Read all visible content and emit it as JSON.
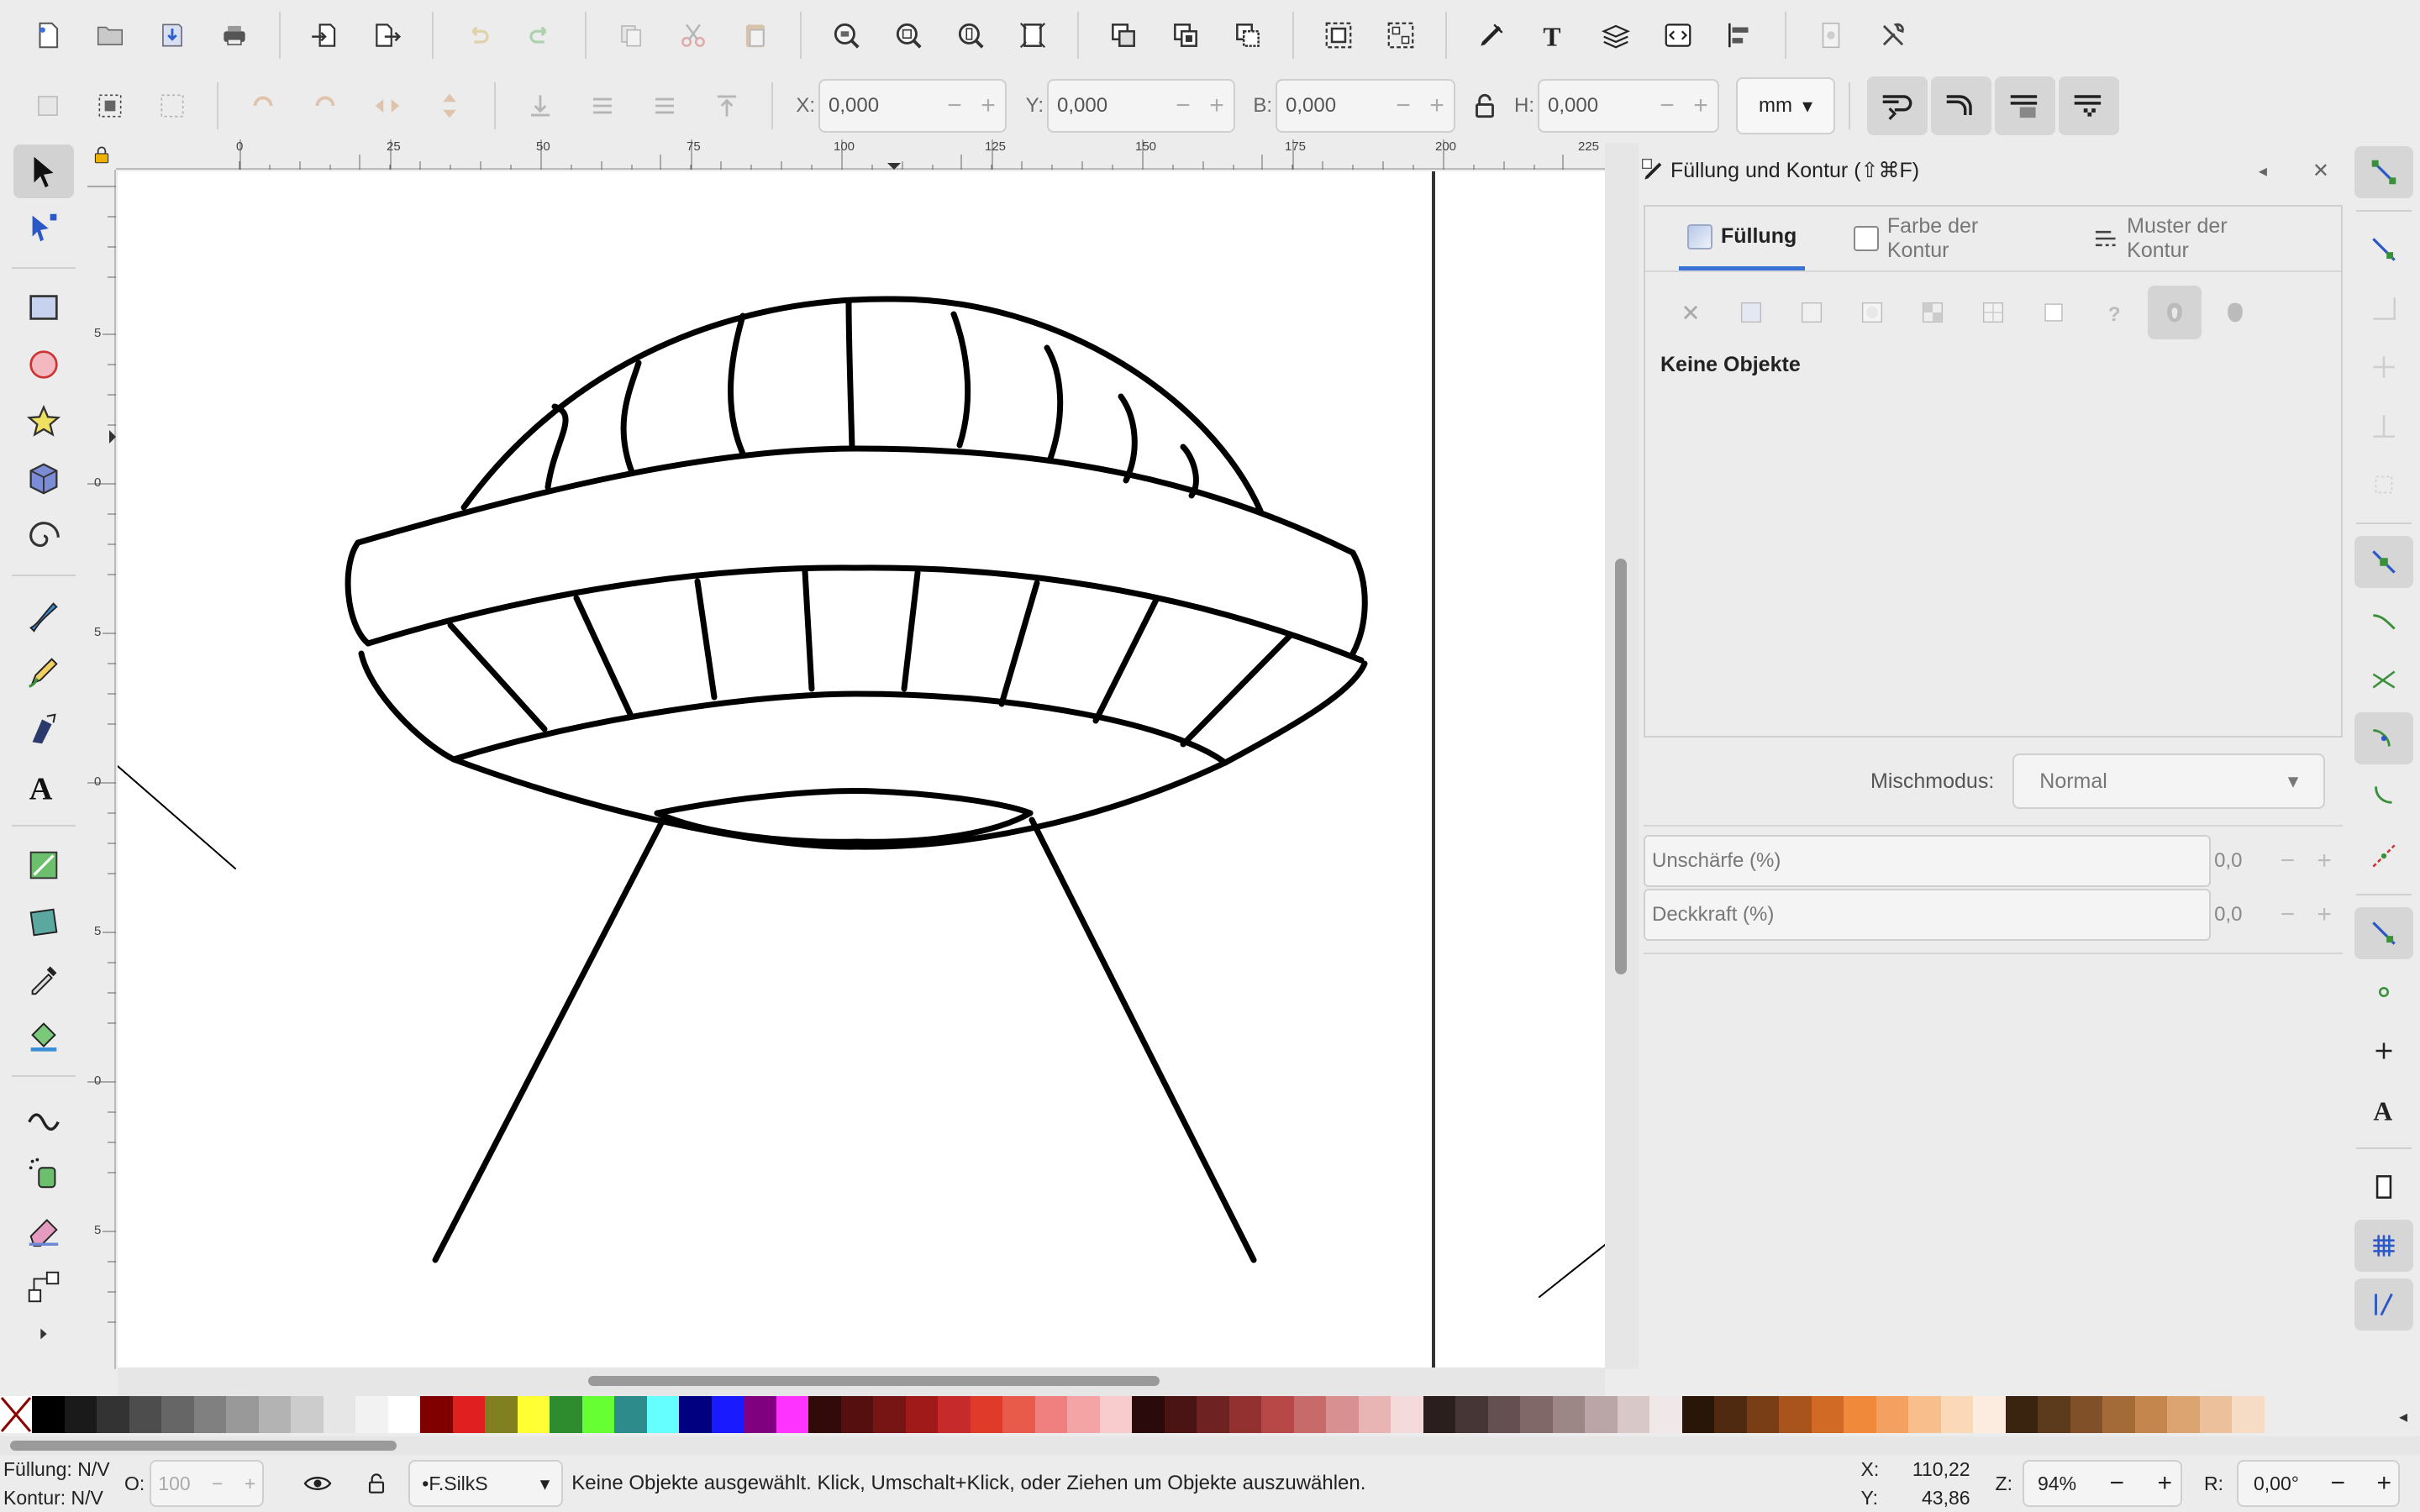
{
  "toolbar": {
    "commands": [
      "new-document",
      "open",
      "save",
      "print",
      "import",
      "export",
      "undo",
      "redo",
      "copy",
      "cut",
      "paste",
      "zoom-selection",
      "zoom-drawing",
      "zoom-page",
      "zoom-page-width",
      "duplicate",
      "clone",
      "unlink-clone",
      "group",
      "ungroup",
      "xml-editor",
      "fill-and-stroke",
      "text-and-font",
      "layers",
      "objects",
      "align-distribute",
      "preferences",
      "document-properties"
    ]
  },
  "controls": {
    "x_label": "X:",
    "x_value": "0,000",
    "y_label": "Y:",
    "y_value": "0,000",
    "w_label": "B:",
    "w_value": "0,000",
    "h_label": "H:",
    "h_value": "0,000",
    "unit": "mm"
  },
  "ruler": {
    "h_labels": [
      "0",
      "25",
      "50",
      "75",
      "100",
      "125",
      "150",
      "175",
      "200",
      "225"
    ],
    "v_labels": [
      "0",
      "5",
      "0",
      "5",
      "0",
      "5",
      "0",
      "5"
    ]
  },
  "dock": {
    "title": "Füllung und Kontur (⇧⌘F)",
    "tabs": [
      "Füllung",
      "Farbe der Kontur",
      "Muster der Kontur"
    ],
    "no_objects": "Keine Objekte",
    "blend_label": "Mischmodus:",
    "blend_value": "Normal",
    "blur_label": "Unschärfe (%)",
    "blur_value": "0,0",
    "opacity_label": "Deckkraft (%)",
    "opacity_value": "0,0"
  },
  "palette": {
    "colors": [
      "#000000",
      "#1a1a1a",
      "#333333",
      "#4d4d4d",
      "#666666",
      "#808080",
      "#999999",
      "#b3b3b3",
      "#cccccc",
      "#e6e6e6",
      "#f2f2f2",
      "#ffffff",
      "#800000",
      "#e02020",
      "#808020",
      "#ffff33",
      "#2e8b2e",
      "#66ff33",
      "#2e8b8b",
      "#66ffff",
      "#000080",
      "#1a1aff",
      "#800080",
      "#ff33ff",
      "#330a0a",
      "#550f0f",
      "#771414",
      "#a01a1a",
      "#c62a2a",
      "#e03a2a",
      "#e85a4a",
      "#f08080",
      "#f4a4a4",
      "#f8cccc",
      "#2a0a0a",
      "#4a1414",
      "#6e2222",
      "#933030",
      "#b84848",
      "#c86a6a",
      "#d89090",
      "#e8b4b4",
      "#f4dada",
      "#2a1e1e",
      "#463636",
      "#645050",
      "#806868",
      "#9c8686",
      "#baa6a6",
      "#d8c8c8",
      "#f0e8e8",
      "#2a1608",
      "#502a10",
      "#7a3e16",
      "#a8541c",
      "#d06a24",
      "#f08a3a",
      "#f4a060",
      "#f8be8c",
      "#fad8b8",
      "#fcece0",
      "#3a2410",
      "#5c3a1c",
      "#805028",
      "#a46a38",
      "#c4864c",
      "#dca470",
      "#ecc09a",
      "#f6dcc4"
    ]
  },
  "status": {
    "fill_label": "Füllung:",
    "fill_value": "N/V",
    "stroke_label": "Kontur:",
    "stroke_value": "N/V",
    "opacity_label": "O:",
    "opacity_value": "100",
    "layer": "•F.SilkS",
    "message": "Keine Objekte ausgewählt. Klick, Umschalt+Klick, oder Ziehen um Objekte auszuwählen.",
    "x_label": "X:",
    "x_value": "110,22",
    "y_label": "Y:",
    "y_value": "43,86",
    "zoom_label": "Z:",
    "zoom_value": "94%",
    "rotation_label": "R:",
    "rotation_value": "0,00°"
  }
}
